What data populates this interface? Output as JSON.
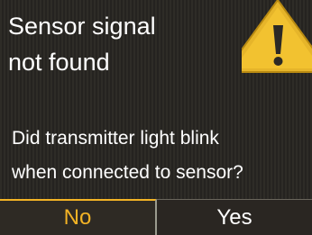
{
  "dialog": {
    "title_line1": "Sensor signal",
    "title_line2": "not found",
    "question_line1": "Did transmitter light blink",
    "question_line2": "when connected to sensor?",
    "warning_icon": "warning-triangle-icon"
  },
  "buttons": {
    "no_label": "No",
    "yes_label": "Yes",
    "selected": "No"
  },
  "colors": {
    "background": "#2b2925",
    "text": "#ffffff",
    "accent": "#f3b325",
    "icon_yellow": "#f2c230"
  }
}
